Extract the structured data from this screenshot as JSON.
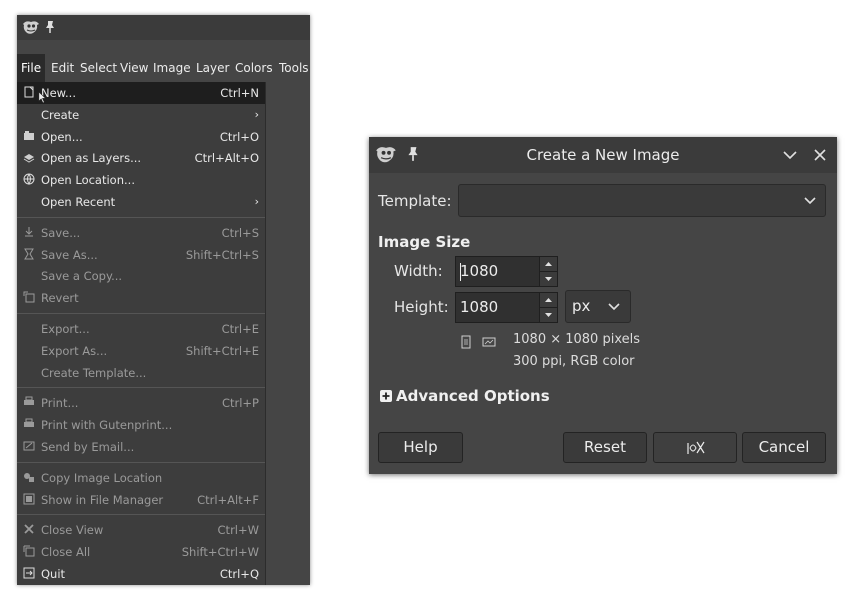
{
  "main_window": {
    "menubar": {
      "items": [
        "File",
        "Edit",
        "Select",
        "View",
        "Image",
        "Layer",
        "Colors",
        "Tools"
      ],
      "active": "File"
    },
    "file_menu": {
      "groups": [
        [
          {
            "label": "New...",
            "accel": "Ctrl+N",
            "icon": "new-image-icon",
            "highlighted": true
          },
          {
            "label": "Create",
            "submenu": true,
            "arrow": "›"
          },
          {
            "label": "Open...",
            "accel": "Ctrl+O",
            "icon": "open-icon"
          },
          {
            "label": "Open as Layers...",
            "accel": "Ctrl+Alt+O",
            "icon": "open-layers-icon"
          },
          {
            "label": "Open Location...",
            "icon": "globe-icon"
          },
          {
            "label": "Open Recent",
            "submenu": true,
            "arrow": "›"
          }
        ],
        [
          {
            "label": "Save...",
            "accel": "Ctrl+S",
            "icon": "save-icon",
            "disabled": true
          },
          {
            "label": "Save As...",
            "accel": "Shift+Ctrl+S",
            "icon": "save-as-icon",
            "disabled": true
          },
          {
            "label": "Save a Copy...",
            "disabled": true
          },
          {
            "label": "Revert",
            "icon": "revert-icon",
            "disabled": true
          }
        ],
        [
          {
            "label": "Export...",
            "accel": "Ctrl+E",
            "disabled": true
          },
          {
            "label": "Export As...",
            "accel": "Shift+Ctrl+E",
            "disabled": true
          },
          {
            "label": "Create Template...",
            "disabled": true
          }
        ],
        [
          {
            "label": "Print...",
            "accel": "Ctrl+P",
            "icon": "print-icon",
            "disabled": true
          },
          {
            "label": "Print with Gutenprint...",
            "icon": "print-icon",
            "disabled": true
          },
          {
            "label": "Send by Email...",
            "icon": "email-icon",
            "disabled": true
          }
        ],
        [
          {
            "label": "Copy Image Location",
            "icon": "copy-location-icon",
            "disabled": true
          },
          {
            "label": "Show in File Manager",
            "accel": "Ctrl+Alt+F",
            "icon": "file-manager-icon",
            "disabled": true
          }
        ],
        [
          {
            "label": "Close View",
            "accel": "Ctrl+W",
            "icon": "close-view-icon",
            "disabled": true
          },
          {
            "label": "Close All",
            "accel": "Shift+Ctrl+W",
            "icon": "close-all-icon",
            "disabled": true
          },
          {
            "label": "Quit",
            "accel": "Ctrl+Q",
            "icon": "quit-icon"
          }
        ]
      ]
    }
  },
  "dialog": {
    "title": "Create a New Image",
    "template_label": "Template:",
    "template_value": "",
    "image_size_heading": "Image Size",
    "width_label": "Width:",
    "width_value": "1080",
    "height_label": "Height:",
    "height_value": "1080",
    "unit": "px",
    "info_pixels": "1080 × 1080 pixels",
    "info_resolution": "300 ppi, RGB color",
    "advanced_label": "Advanced Options",
    "buttons": {
      "help": "Help",
      "reset": "Reset",
      "cancel": "Cancel"
    }
  },
  "colors": {
    "menu_bg": "#3d3d3d",
    "menu_highlight": "#1e1e1e",
    "dialog_bg": "#454545",
    "titlebar": "#3b3b3b",
    "text": "#ececec",
    "disabled_text": "#9a9a9a"
  }
}
